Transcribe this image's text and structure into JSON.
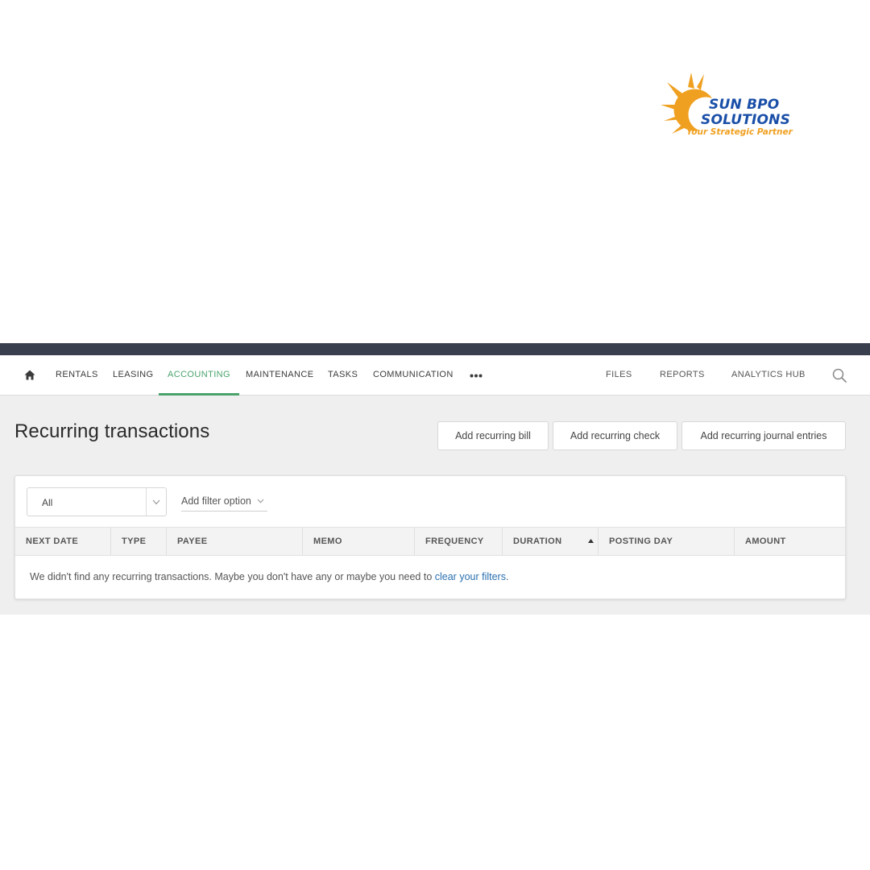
{
  "logo": {
    "line1": "SUN BPO",
    "line2": "SOLUTIONS",
    "tagline": "Your Strategic Partner"
  },
  "nav": {
    "home_icon": "home-icon",
    "items": [
      {
        "label": "RENTALS"
      },
      {
        "label": "LEASING"
      },
      {
        "label": "ACCOUNTING",
        "active": true
      },
      {
        "label": "MAINTENANCE"
      },
      {
        "label": "TASKS"
      },
      {
        "label": "COMMUNICATION"
      }
    ],
    "more_icon": "more-dots-icon",
    "right_items": [
      {
        "label": "FILES"
      },
      {
        "label": "REPORTS"
      },
      {
        "label": "ANALYTICS HUB"
      }
    ],
    "search_icon": "search-icon",
    "active_color": "#4aa36c"
  },
  "page": {
    "title": "Recurring transactions",
    "buttons": [
      {
        "label": "Add recurring bill"
      },
      {
        "label": "Add recurring check"
      },
      {
        "label": "Add recurring journal entries"
      }
    ]
  },
  "filters": {
    "select_value": "All",
    "add_filter_label": "Add filter option"
  },
  "table": {
    "columns": [
      {
        "label": "NEXT DATE"
      },
      {
        "label": "TYPE"
      },
      {
        "label": "PAYEE"
      },
      {
        "label": "MEMO"
      },
      {
        "label": "FREQUENCY"
      },
      {
        "label": "DURATION",
        "sorted": "asc"
      },
      {
        "label": "POSTING DAY"
      },
      {
        "label": "AMOUNT"
      }
    ],
    "empty_text": "We didn't find any recurring transactions. Maybe you don't have any or maybe you need to ",
    "empty_link": "clear your filters",
    "empty_suffix": "."
  },
  "colors": {
    "topbar": "#3a3f4e",
    "accent_green": "#4aa36c",
    "link_blue": "#2a6fb0",
    "logo_orange": "#f0a020",
    "logo_blue": "#1a4fa8"
  }
}
